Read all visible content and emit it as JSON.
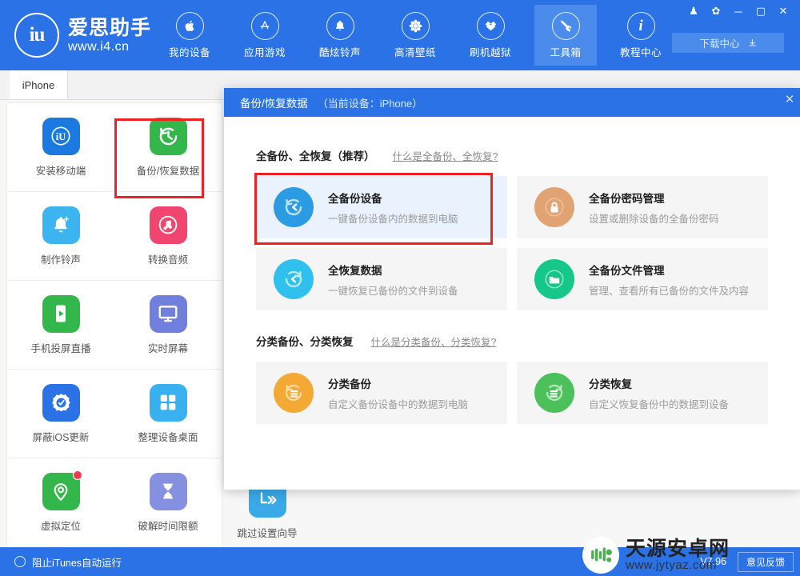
{
  "header": {
    "logo_mark": "iu",
    "logo_title": "爱思助手",
    "logo_url": "www.i4.cn",
    "nav": [
      {
        "label": "我的设备",
        "icon": "apple-icon",
        "active": false
      },
      {
        "label": "应用游戏",
        "icon": "appstore-icon",
        "active": false
      },
      {
        "label": "酷炫铃声",
        "icon": "bell-icon",
        "active": false
      },
      {
        "label": "高清壁纸",
        "icon": "flower-icon",
        "active": false
      },
      {
        "label": "刷机越狱",
        "icon": "openbox-icon",
        "active": false
      },
      {
        "label": "工具箱",
        "icon": "tools-icon",
        "active": true
      },
      {
        "label": "教程中心",
        "icon": "info-icon",
        "active": false
      }
    ],
    "window_buttons": [
      {
        "name": "skin-icon",
        "glyph": "♟"
      },
      {
        "name": "settings-gear-icon",
        "glyph": "✿"
      },
      {
        "name": "minimize-icon",
        "glyph": "─"
      },
      {
        "name": "maximize-icon",
        "glyph": "▢"
      },
      {
        "name": "close-icon",
        "glyph": "✕"
      }
    ],
    "download_center": "下载中心"
  },
  "tabs": [
    {
      "label": "iPhone",
      "active": true
    }
  ],
  "sidebar": {
    "rows": [
      [
        {
          "label": "安装移动端",
          "icon": "i4-app-icon",
          "color": "#1a7ae0",
          "badge": false
        },
        {
          "label": "备份/恢复数据",
          "icon": "backup-restore-icon",
          "color": "#33b74a",
          "badge": false
        }
      ],
      [
        {
          "label": "制作铃声",
          "icon": "ringtone-bell-icon",
          "color": "#3cb4f0",
          "badge": false
        },
        {
          "label": "转换音频",
          "icon": "audio-convert-icon",
          "color": "#f0456e",
          "badge": false
        }
      ],
      [
        {
          "label": "手机投屏直播",
          "icon": "screen-cast-icon",
          "color": "#33b74a",
          "badge": false
        },
        {
          "label": "实时屏幕",
          "icon": "live-screen-icon",
          "color": "#6f7fdb",
          "badge": false
        }
      ],
      [
        {
          "label": "屏蔽iOS更新",
          "icon": "block-update-icon",
          "color": "#2a72e5",
          "badge": false
        },
        {
          "label": "整理设备桌面",
          "icon": "arrange-desktop-icon",
          "color": "#39b0f0",
          "badge": false
        }
      ],
      [
        {
          "label": "虚拟定位",
          "icon": "location-pin-icon",
          "color": "#33b74a",
          "badge": true
        },
        {
          "label": "破解时间限额",
          "icon": "hourglass-icon",
          "color": "#8590e0",
          "badge": false
        }
      ]
    ],
    "extra_tile": {
      "label": "跳过设置向导",
      "icon": "skip-setup-icon",
      "color": "#39a9e8"
    }
  },
  "dialog": {
    "title": "备份/恢复数据",
    "device_text": "（当前设备：iPhone）",
    "close_glyph": "✕",
    "sections": [
      {
        "title": "全备份、全恢复（推荐）",
        "link": "什么是全备份、全恢复?",
        "cards": [
          {
            "title": "全备份设备",
            "sub": "一键备份设备内的数据到电脑",
            "icon": "full-backup-icon",
            "color": "#2b9be3",
            "selected": true
          },
          {
            "title": "全备份密码管理",
            "sub": "设置或删除设备的全备份密码",
            "icon": "lock-icon",
            "color": "#e2a373",
            "selected": false
          },
          {
            "title": "全恢复数据",
            "sub": "一键恢复已备份的文件到设备",
            "icon": "full-restore-icon",
            "color": "#2fc0ee",
            "selected": false
          },
          {
            "title": "全备份文件管理",
            "sub": "管理、查看所有已备份的文件及内容",
            "icon": "folder-icon",
            "color": "#16c78a",
            "selected": false
          }
        ]
      },
      {
        "title": "分类备份、分类恢复",
        "link": "什么是分类备份、分类恢复?",
        "cards": [
          {
            "title": "分类备份",
            "sub": "自定义备份设备中的数据到电脑",
            "icon": "category-backup-icon",
            "color": "#f5a935",
            "selected": false
          },
          {
            "title": "分类恢复",
            "sub": "自定义恢复备份中的数据到设备",
            "icon": "category-restore-icon",
            "color": "#4cc05a",
            "selected": false
          }
        ]
      }
    ]
  },
  "statusbar": {
    "itunes_label": "阻止iTunes自动运行",
    "version": "V7.96",
    "feedback": "意见反馈"
  },
  "watermark": {
    "title": "天源安卓网",
    "url": "www.jytyaz.com"
  },
  "colors": {
    "brand_blue": "#2a72e5",
    "nav_active": "#4a8bec",
    "highlight_red": "#ee2222",
    "card_bg": "#f5f5f5",
    "card_selected_bg": "#e9f2fd"
  }
}
